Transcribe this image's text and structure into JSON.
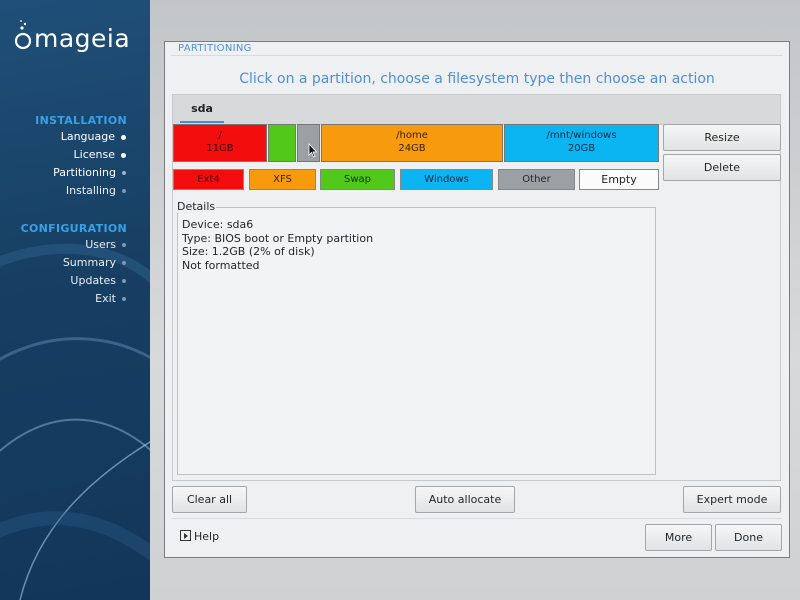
{
  "sidebar": {
    "logo_text": "mageia",
    "installation_title": "INSTALLATION",
    "installation_steps": [
      "Language",
      "License",
      "Partitioning",
      "Installing"
    ],
    "configuration_title": "CONFIGURATION",
    "configuration_steps": [
      "Users",
      "Summary",
      "Updates",
      "Exit"
    ]
  },
  "window": {
    "title": "PARTITIONING",
    "instruction": "Click on a partition, choose a filesystem type then choose an action",
    "tab": "sda"
  },
  "partitions": [
    {
      "mount": "/",
      "size": "11GB",
      "type": "Ext4",
      "color": "#f40d0d"
    },
    {
      "mount": "",
      "size": "",
      "type": "Swap",
      "color": "#52c81a"
    },
    {
      "mount": "",
      "size": "",
      "type": "Empty",
      "color": "#9ba0a5"
    },
    {
      "mount": "/home",
      "size": "24GB",
      "type": "XFS",
      "color": "#f89a0e"
    },
    {
      "mount": "/mnt/windows",
      "size": "20GB",
      "type": "Windows",
      "color": "#0ab5f2"
    }
  ],
  "legend": {
    "ext4": "Ext4",
    "xfs": "XFS",
    "swap": "Swap",
    "windows": "Windows",
    "other": "Other",
    "empty": "Empty"
  },
  "actions": {
    "resize": "Resize",
    "delete": "Delete"
  },
  "details": {
    "label": "Details",
    "device": "Device: sda6",
    "type": "Type: BIOS boot or Empty partition",
    "size": "Size: 1.2GB (2% of disk)",
    "formatted": "Not formatted"
  },
  "bottom": {
    "clear_all": "Clear all",
    "auto_allocate": "Auto allocate",
    "expert_mode": "Expert mode",
    "help": "Help",
    "more": "More",
    "done": "Done"
  },
  "colors": {
    "accent": "#4f8fd6",
    "sidebar": "#173f63",
    "section_title": "#3aa0e6"
  }
}
